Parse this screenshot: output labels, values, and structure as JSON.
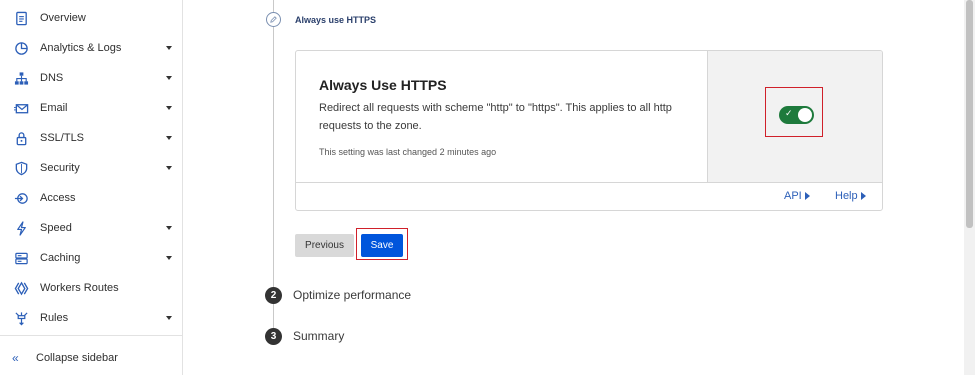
{
  "sidebar": {
    "items": [
      {
        "label": "Overview",
        "icon": "document-icon",
        "caret": false
      },
      {
        "label": "Analytics & Logs",
        "icon": "chart-pie-icon",
        "caret": true
      },
      {
        "label": "DNS",
        "icon": "network-icon",
        "caret": true
      },
      {
        "label": "Email",
        "icon": "email-icon",
        "caret": true
      },
      {
        "label": "SSL/TLS",
        "icon": "lock-icon",
        "caret": true
      },
      {
        "label": "Security",
        "icon": "shield-icon",
        "caret": true
      },
      {
        "label": "Access",
        "icon": "access-icon",
        "caret": false
      },
      {
        "label": "Speed",
        "icon": "lightning-icon",
        "caret": true
      },
      {
        "label": "Caching",
        "icon": "server-icon",
        "caret": true
      },
      {
        "label": "Workers Routes",
        "icon": "workers-icon",
        "caret": false
      },
      {
        "label": "Rules",
        "icon": "rules-icon",
        "caret": true
      }
    ],
    "collapse_label": "Collapse sidebar"
  },
  "wizard": {
    "step1_title": "Always use HTTPS",
    "card": {
      "title": "Always Use HTTPS",
      "description": "Redirect all requests with scheme \"http\" to \"https\". This applies to all http requests to the zone.",
      "meta": "This setting was last changed 2 minutes ago",
      "toggle_on": true,
      "api_link": "API",
      "help_link": "Help"
    },
    "previous_label": "Previous",
    "save_label": "Save",
    "step2_num": "2",
    "step2_label": "Optimize performance",
    "step3_num": "3",
    "step3_label": "Summary"
  },
  "colors": {
    "accent": "#0055dc",
    "toggle_on": "#1e7a3c",
    "highlight": "#d0202a",
    "link": "#2c5fb8"
  }
}
